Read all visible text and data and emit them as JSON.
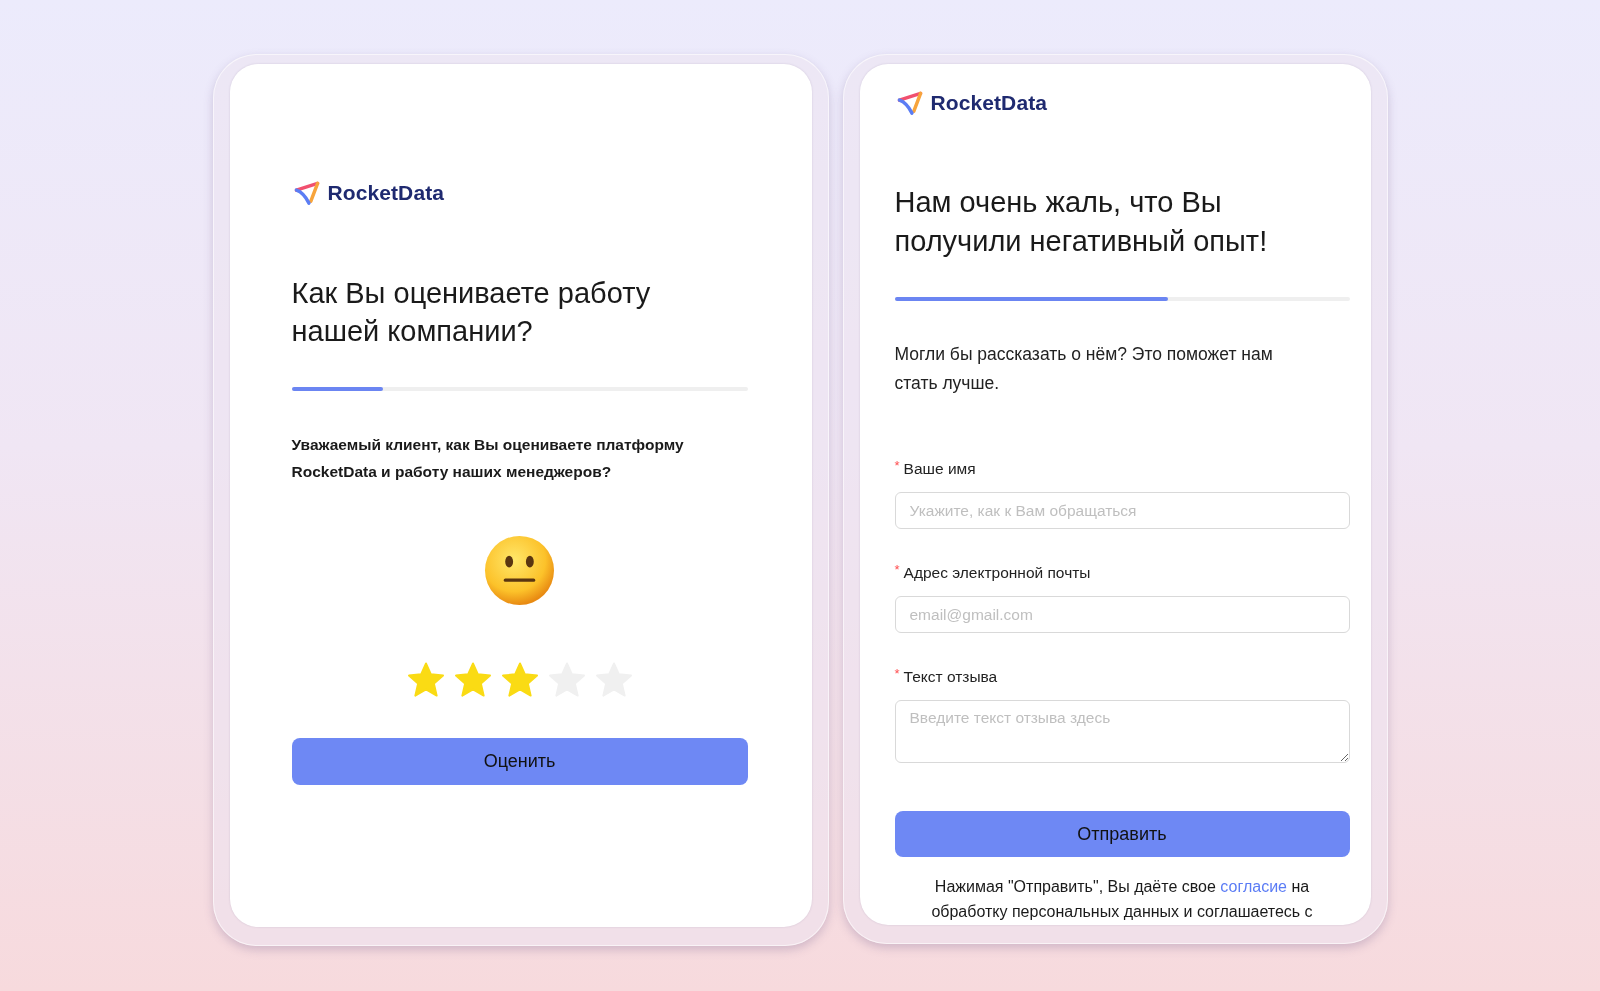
{
  "rating_card": {
    "logo": {
      "text": "RocketData"
    },
    "title": "Как Вы оцениваете работу нашей компании?",
    "progress": {
      "level": 0.2
    },
    "description": "Уважаемый клиент, как Вы оцениваете платформу RocketData и работу наших менеджеров?",
    "rating": {
      "stars": 3
    },
    "submit_button": "Оценить"
  },
  "feedback_card": {
    "logo": {
      "text": "RocketData"
    },
    "title": "Нам очень жаль, что Вы получили негативный опыт!",
    "progress": {
      "level": 0.6
    },
    "description": "Могли бы рассказать о нём? Это поможет нам стать лучше.",
    "fields": [
      {
        "kind": "input",
        "required_mark": "*",
        "label": "Ваше имя",
        "placeholder": "Укажите, как к Вам обращаться"
      },
      {
        "kind": "input",
        "required_mark": "*",
        "label": "Адрес электронной почты",
        "placeholder": "email@gmail.com"
      },
      {
        "kind": "textarea",
        "required_mark": "*",
        "label": "Текст отзыва",
        "placeholder": "Введите текст отзыва здесь"
      }
    ],
    "submit_button": "Отправить",
    "consent": {
      "before": "Нажимая \"Отправить\", Вы даёте свое",
      "link": "согласие",
      "after": "на обработку персональных данных и соглашаетесь с"
    }
  }
}
